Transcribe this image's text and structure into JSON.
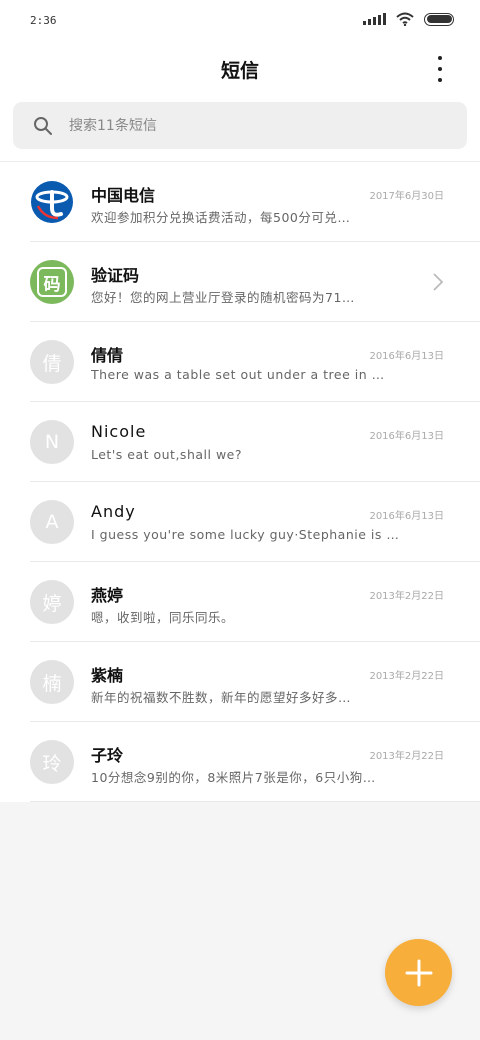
{
  "status": {
    "time": "2:36"
  },
  "header": {
    "title": "短信"
  },
  "search": {
    "placeholder": "搜索11条短信"
  },
  "conversations": [
    {
      "name": "中国电信",
      "date": "2017年6月30日",
      "preview": "欢迎参加积分兑换话费活动，每500分可兑…",
      "avatar": "telecom-logo"
    },
    {
      "name": "验证码",
      "date": "",
      "preview": "您好！您的网上营业厅登录的随机密码为71…",
      "avatar": "码"
    },
    {
      "name": "倩倩",
      "date": "2016年6月13日",
      "preview": "There was a table set out under a tree in …",
      "avatar": "倩"
    },
    {
      "name": "Nicole",
      "date": "2016年6月13日",
      "preview": "Let's eat out,shall we?",
      "avatar": "N"
    },
    {
      "name": "Andy",
      "date": "2016年6月13日",
      "preview": "I guess you're some lucky guy·Stephanie is …",
      "avatar": "A"
    },
    {
      "name": "燕婷",
      "date": "2013年2月22日",
      "preview": "嗯，收到啦，同乐同乐。",
      "avatar": "婷"
    },
    {
      "name": "紫楠",
      "date": "2013年2月22日",
      "preview": "新年的祝福数不胜数，新年的愿望好多好多…",
      "avatar": "楠"
    },
    {
      "name": "子玲",
      "date": "2013年2月22日",
      "preview": "10分想念9别的你，8米照片7张是你，6只小狗…",
      "avatar": "玲"
    }
  ],
  "colors": {
    "accent": "#f7ae3a",
    "telecom_blue": "#0a5ab0",
    "verify_green": "#7cb85c"
  }
}
